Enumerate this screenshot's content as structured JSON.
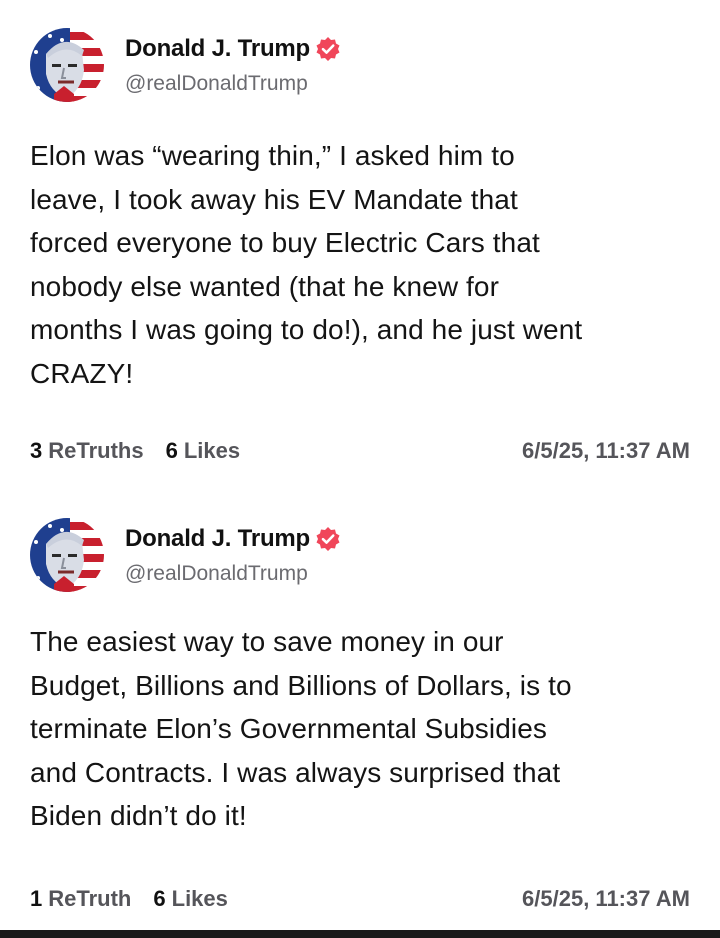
{
  "posts": [
    {
      "author": {
        "name": "Donald J. Trump",
        "handle": "@realDonaldTrump",
        "avatar": "avatar-portrait-flag-icon",
        "verified": "verified-badge-icon"
      },
      "lines": [
        "Elon was “wearing thin,” I asked him to",
        "leave, I took away his EV Mandate that",
        "forced everyone to buy Electric Cars that",
        "nobody else wanted (that he knew for",
        "months I was going to do!), and he just went",
        "CRAZY!"
      ],
      "retruths_count": "3",
      "retruths_label": "ReTruths",
      "likes_count": "6",
      "likes_label": "Likes",
      "timestamp": "6/5/25, 11:37 AM"
    },
    {
      "author": {
        "name": "Donald J. Trump",
        "handle": "@realDonaldTrump",
        "avatar": "avatar-portrait-flag-icon",
        "verified": "verified-badge-icon"
      },
      "lines": [
        "The easiest way to save money in our",
        "Budget, Billions and Billions of Dollars, is to",
        "terminate Elon’s Governmental Subsidies",
        "and Contracts. I was always surprised that",
        "Biden didn’t do it!"
      ],
      "retruths_count": "1",
      "retruths_label": "ReTruth",
      "likes_count": "6",
      "likes_label": "Likes",
      "timestamp": "6/5/25, 11:37 AM"
    }
  ],
  "colors": {
    "verified_badge": "#f0465a",
    "flag_red": "#c8202e",
    "flag_blue": "#1f3f8f",
    "muted_text": "#55555a",
    "handle_text": "#6b6b70"
  }
}
